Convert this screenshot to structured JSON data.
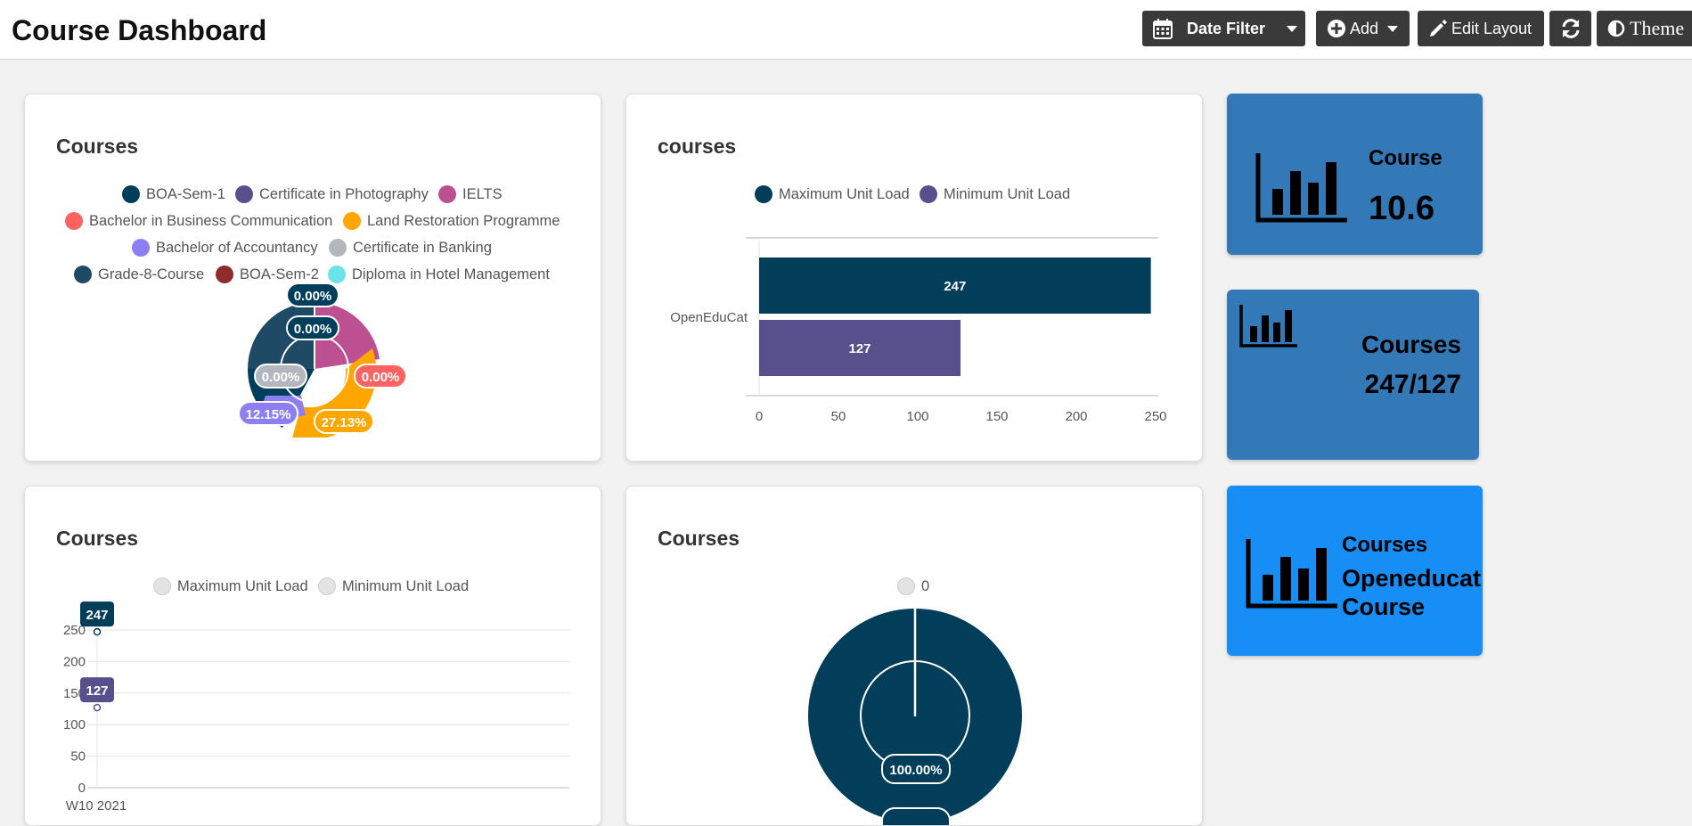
{
  "header": {
    "title": "Course Dashboard",
    "date_filter_label": "Date Filter",
    "add_label": "Add",
    "edit_layout_label": "Edit Layout",
    "theme_label": "Theme"
  },
  "colors": {
    "navy": "#023e5a",
    "purple": "#58508d",
    "stat_blue": "#3379b7",
    "stat_bright": "#168ef5",
    "toolbar_button": "#3a3a3a"
  },
  "widgets": {
    "pie_courses": {
      "title": "Courses",
      "legend": [
        {
          "label": "BOA-Sem-1",
          "color": "#003f5c"
        },
        {
          "label": "Certificate in Photography",
          "color": "#58508d"
        },
        {
          "label": "IELTS",
          "color": "#bc5090"
        },
        {
          "label": "Bachelor in Business Communication",
          "color": "#ff6361"
        },
        {
          "label": "Land Restoration Programme",
          "color": "#ffa600"
        },
        {
          "label": "Bachelor of Accountancy",
          "color": "#8d7ff2"
        },
        {
          "label": "Certificate in Banking",
          "color": "#b3b6bd"
        },
        {
          "label": "Grade-8-Course",
          "color": "#1f4a66"
        },
        {
          "label": "BOA-Sem-2",
          "color": "#8e2b2b"
        },
        {
          "label": "Diploma in Hotel Management",
          "color": "#6ae3ea"
        }
      ]
    },
    "bar_courses": {
      "title": "courses",
      "legend": [
        {
          "label": "Maximum Unit Load",
          "color": "#023e5a"
        },
        {
          "label": "Minimum Unit Load",
          "color": "#58508d"
        }
      ]
    },
    "line_courses": {
      "title": "Courses",
      "legend": [
        {
          "label": "Maximum Unit Load"
        },
        {
          "label": "Minimum Unit Load"
        }
      ]
    },
    "donut_courses": {
      "title": "Courses",
      "legend": [
        {
          "label": "0"
        }
      ]
    },
    "stat_course": {
      "title": "Course",
      "value": "10.6"
    },
    "stat_courses_ratio": {
      "title": "Courses",
      "value": "247/127"
    },
    "stat_courses_text": {
      "title": "Courses",
      "value": "Openeducat Course"
    }
  },
  "chart_data": [
    {
      "type": "pie",
      "title": "Courses",
      "series": [
        {
          "name": "BOA-Sem-1",
          "value": 0.0
        },
        {
          "name": "Certificate in Photography",
          "value": 0.0
        },
        {
          "name": "IELTS",
          "value": null
        },
        {
          "name": "Bachelor in Business Communication",
          "value": 0.0
        },
        {
          "name": "Land Restoration Programme",
          "value": 27.13
        },
        {
          "name": "Bachelor of Accountancy",
          "value": 12.15
        },
        {
          "name": "Certificate in Banking",
          "value": 0.0
        },
        {
          "name": "Grade-8-Course",
          "value": null
        },
        {
          "name": "BOA-Sem-2",
          "value": null
        },
        {
          "name": "Diploma in Hotel Management",
          "value": null
        }
      ],
      "data_labels": [
        "0.00%",
        "0.00%",
        "0.00%",
        "0.00%",
        "12.15%",
        "27.13%"
      ]
    },
    {
      "type": "bar",
      "title": "courses",
      "orientation": "horizontal",
      "categories": [
        "OpenEduCat"
      ],
      "series": [
        {
          "name": "Maximum Unit Load",
          "values": [
            247
          ]
        },
        {
          "name": "Minimum Unit Load",
          "values": [
            127
          ]
        }
      ],
      "xlim": [
        0,
        250
      ],
      "xticks": [
        0,
        50,
        100,
        150,
        200,
        250
      ],
      "legend": "top"
    },
    {
      "type": "line",
      "title": "Courses",
      "categories": [
        "W10 2021"
      ],
      "series": [
        {
          "name": "Maximum Unit Load",
          "values": [
            247
          ]
        },
        {
          "name": "Minimum Unit Load",
          "values": [
            127
          ]
        }
      ],
      "ylim": [
        0,
        250
      ],
      "yticks": [
        0,
        50,
        100,
        150,
        200,
        250
      ],
      "grid": true,
      "legend": "top"
    },
    {
      "type": "pie",
      "title": "Courses",
      "series": [
        {
          "name": "0",
          "value": 100.0
        }
      ],
      "data_labels": [
        "100.00%"
      ]
    }
  ]
}
